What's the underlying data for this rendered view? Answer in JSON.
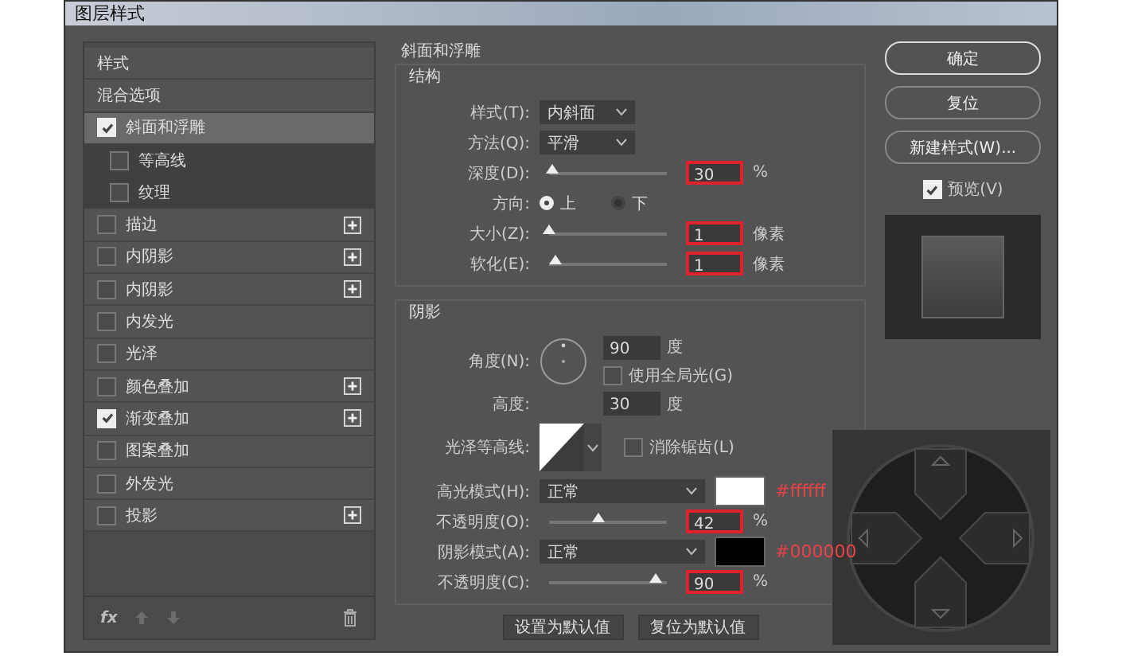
{
  "window": {
    "title": "图层样式"
  },
  "styles_list": {
    "items": [
      {
        "label": "样式",
        "kind": "header",
        "selected": false
      },
      {
        "label": "混合选项",
        "kind": "header",
        "selected": false
      },
      {
        "label": "斜面和浮雕",
        "kind": "effect",
        "checked": true,
        "selected": true,
        "addable": false,
        "children": [
          {
            "label": "等高线",
            "checked": false,
            "selected": false
          },
          {
            "label": "纹理",
            "checked": false,
            "selected": false
          }
        ]
      },
      {
        "label": "描边",
        "kind": "effect",
        "checked": false,
        "selected": false,
        "addable": true
      },
      {
        "label": "内阴影",
        "kind": "effect",
        "checked": false,
        "selected": false,
        "addable": true
      },
      {
        "label": "内阴影",
        "kind": "effect",
        "checked": false,
        "selected": false,
        "addable": true
      },
      {
        "label": "内发光",
        "kind": "effect",
        "checked": false,
        "selected": false,
        "addable": false
      },
      {
        "label": "光泽",
        "kind": "effect",
        "checked": false,
        "selected": false,
        "addable": false
      },
      {
        "label": "颜色叠加",
        "kind": "effect",
        "checked": false,
        "selected": false,
        "addable": true
      },
      {
        "label": "渐变叠加",
        "kind": "effect",
        "checked": true,
        "selected": false,
        "addable": true
      },
      {
        "label": "图案叠加",
        "kind": "effect",
        "checked": false,
        "selected": false,
        "addable": false
      },
      {
        "label": "外发光",
        "kind": "effect",
        "checked": false,
        "selected": false,
        "addable": false
      },
      {
        "label": "投影",
        "kind": "effect",
        "checked": false,
        "selected": false,
        "addable": true
      }
    ],
    "effects_button": {
      "label": "fx"
    }
  },
  "bevel": {
    "title": "斜面和浮雕",
    "structure": {
      "title": "结构",
      "style": {
        "label": "样式(T):",
        "value": "内斜面"
      },
      "technique": {
        "label": "方法(Q):",
        "value": "平滑"
      },
      "depth": {
        "label": "深度(D):",
        "level": 0.03,
        "value": "30",
        "unit": "%",
        "highlighted": true
      },
      "direction": {
        "label": "方向:",
        "options": [
          {
            "label": "上",
            "selected": true
          },
          {
            "label": "下",
            "selected": false
          }
        ]
      },
      "size": {
        "label": "大小(Z):",
        "level": 0.0,
        "value": "1",
        "unit": "像素",
        "highlighted": true
      },
      "soften": {
        "label": "软化(E):",
        "level": 0.06,
        "value": "1",
        "unit": "像素",
        "highlighted": true
      }
    },
    "shading": {
      "title": "阴影",
      "angle": {
        "label": "角度(N):",
        "value": "90",
        "unit": "度"
      },
      "global_light": {
        "label": "使用全局光(G)",
        "checked": false
      },
      "altitude": {
        "label": "高度:",
        "value": "30",
        "unit": "度"
      },
      "gloss_contour": {
        "label": "光泽等高线:"
      },
      "anti_aliased": {
        "label": "消除锯齿(L)",
        "checked": false
      },
      "highlight_mode": {
        "label": "高光模式(H):",
        "value": "正常",
        "color": "#ffffff",
        "note": "#ffffff"
      },
      "highlight_opacity": {
        "label": "不透明度(O):",
        "level": 0.42,
        "value": "42",
        "unit": "%",
        "highlighted": true
      },
      "shadow_mode": {
        "label": "阴影模式(A):",
        "value": "正常",
        "color": "#000000",
        "note": "#000000"
      },
      "shadow_opacity": {
        "label": "不透明度(C):",
        "level": 0.9,
        "value": "90",
        "unit": "%",
        "highlighted": true
      }
    },
    "buttons": [
      {
        "label": "设置为默认值"
      },
      {
        "label": "复位为默认值"
      }
    ]
  },
  "actions": [
    {
      "label": "确定",
      "kind": "default"
    },
    {
      "label": "复位",
      "kind": "normal"
    },
    {
      "label": "新建样式(W)...",
      "kind": "normal"
    }
  ],
  "preview": {
    "label": "预览(V)",
    "checked": true
  }
}
